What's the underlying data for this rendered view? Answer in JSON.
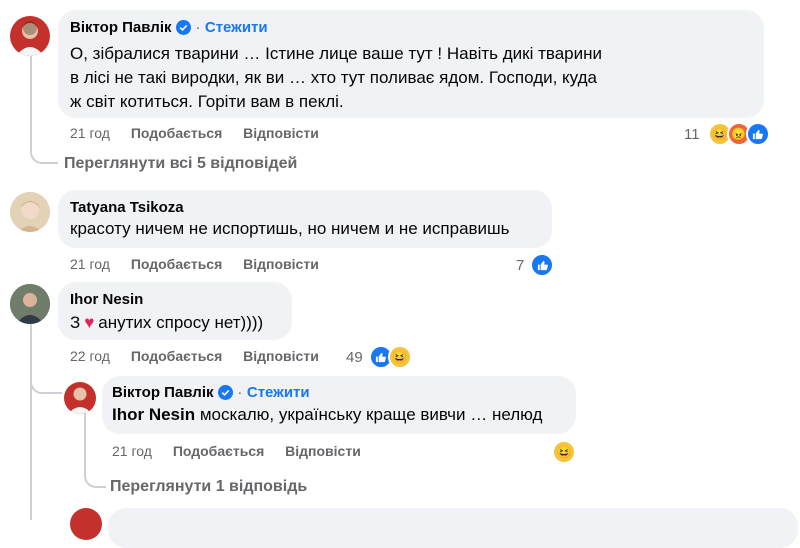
{
  "comment1": {
    "author": "Віктор Павлік",
    "follow": "Стежити",
    "text": "О, зібралися тварини … Істине лице ваше тут ! Навіть дикі тварини в лісі не такі виродки, як ви … хто тут поливає ядом. Господи, куда ж світ котиться. Горіти вам в пеклі.",
    "time": "21 год",
    "like": "Подобається",
    "reply": "Відповісти",
    "reactions_count": "11",
    "view_replies": "Переглянути всі 5 відповідей"
  },
  "comment2": {
    "author": "Tatyana Tsikoza",
    "text": "красоту ничем не испортишь, но ничем и не исправишь",
    "time": "21 год",
    "like": "Подобається",
    "reply": "Відповісти",
    "reactions_count": "7"
  },
  "comment3": {
    "author": "Ihor Nesin",
    "text_prefix": "З",
    "text_suffix": "анутих спросу нет))))",
    "time": "22 год",
    "like": "Подобається",
    "reply": "Відповісти",
    "reactions_count": "49"
  },
  "reply1": {
    "author": "Віктор Павлік",
    "follow": "Стежити",
    "mention": "Ihor Nesin",
    "text": "москалю, українську краще вивчи … нелюд",
    "time": "21 год",
    "like": "Подобається",
    "reply": "Відповісти",
    "view_replies": "Переглянути 1 відповідь"
  },
  "icons": [
    "verified-icon",
    "like-reaction-icon",
    "haha-reaction-icon",
    "angry-reaction-icon"
  ],
  "colors": {
    "link": "#1877f2",
    "bubble": "#f0f2f5",
    "meta": "#65676b"
  }
}
